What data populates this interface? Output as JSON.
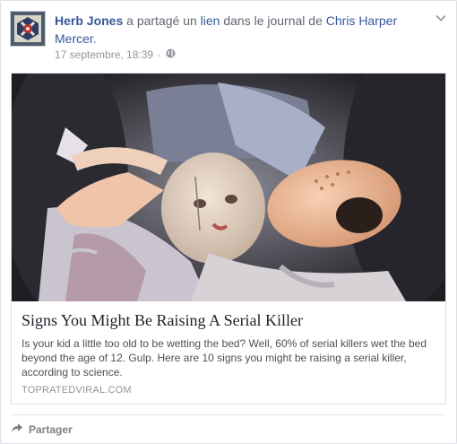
{
  "post": {
    "author": "Herb Jones",
    "action_part1": "a partagé un",
    "action_link": "lien",
    "action_part2": "dans le journal de",
    "target": "Chris Harper Mercer",
    "period": ".",
    "timestamp": "17 septembre, 18:39",
    "separator": "·",
    "privacy_icon": "globe-icon",
    "options_icon": "chevron-down-icon"
  },
  "link": {
    "title": "Signs You Might Be Raising A Serial Killer",
    "description": "Is your kid a little too old to be wetting the bed? Well, 60% of serial killers wet the bed beyond the age of 12. Gulp. Here are 10 signs you might be raising a serial killer, according to science.",
    "source": "TOPRATEDVIRAL.COM"
  },
  "actions": {
    "share_label": "Partager",
    "share_icon": "share-arrow-icon"
  },
  "colors": {
    "link_blue": "#365899",
    "meta_gray": "#90949c",
    "border": "#dddfe2"
  }
}
